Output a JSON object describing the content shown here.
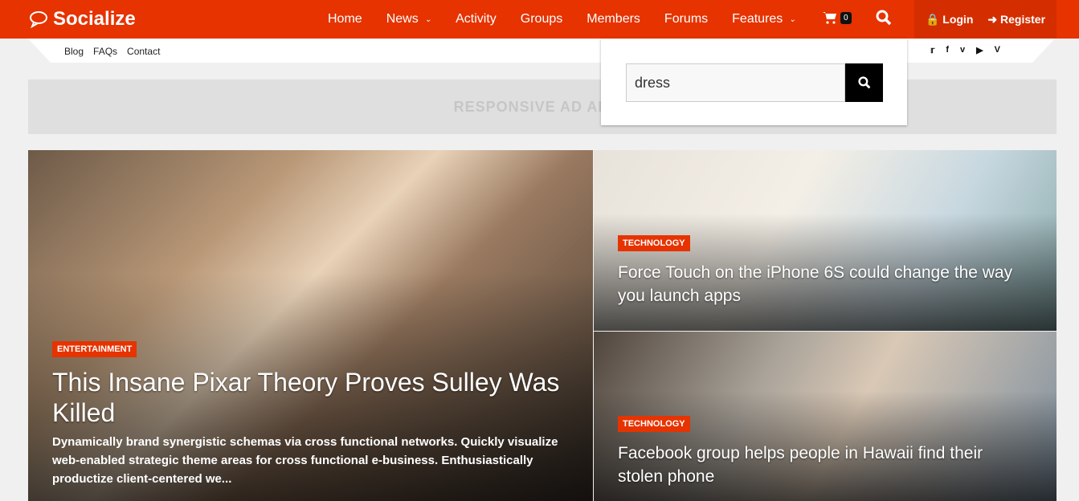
{
  "header": {
    "logo": "Socialize",
    "nav": [
      {
        "label": "Home"
      },
      {
        "label": "News",
        "dropdown": true
      },
      {
        "label": "Activity"
      },
      {
        "label": "Groups"
      },
      {
        "label": "Members"
      },
      {
        "label": "Forums"
      },
      {
        "label": "Features",
        "dropdown": true
      }
    ],
    "cart_count": "0",
    "login": "Login",
    "register": "Register",
    "accent": "#e63300"
  },
  "subnav": {
    "links": [
      "Blog",
      "FAQs",
      "Contact"
    ],
    "social": [
      "twitter-icon",
      "facebook-icon",
      "vimeo-icon",
      "youtube-icon",
      "vine-icon"
    ]
  },
  "ad": {
    "text": "RESPONSIVE AD AREA"
  },
  "search": {
    "value": "dress"
  },
  "posts": [
    {
      "category": "ENTERTAINMENT",
      "title": "This Insane Pixar Theory Proves Sulley Was Killed",
      "excerpt": "Dynamically brand synergistic schemas via cross functional networks. Quickly visualize web-enabled strategic theme areas for cross functional e-business. Enthusiastically productize client-centered we..."
    },
    {
      "category": "TECHNOLOGY",
      "title": "Force Touch on the iPhone 6S could change the way you launch apps"
    },
    {
      "category": "TECHNOLOGY",
      "title": "Facebook group helps people in Hawaii find their stolen phone"
    }
  ]
}
